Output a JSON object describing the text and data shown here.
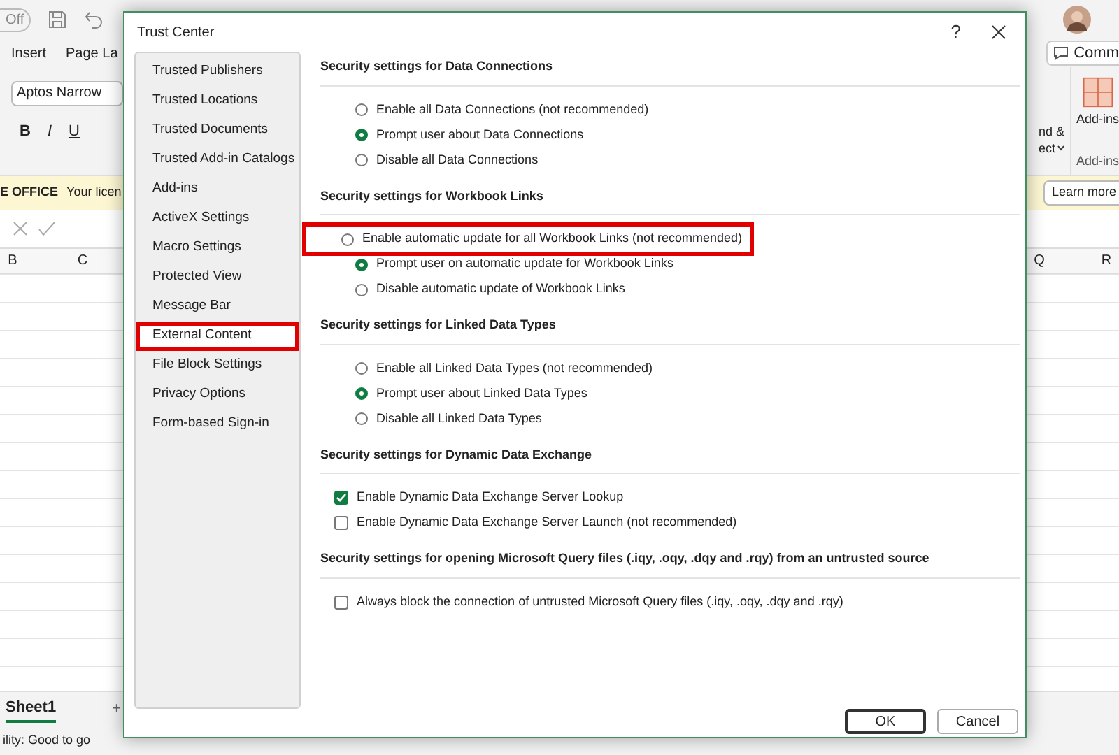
{
  "excel": {
    "autosave": "Off",
    "ribbon_tabs": [
      "Insert",
      "Page La"
    ],
    "font_box": "Aptos Narrow",
    "format_buttons": [
      "B",
      "I",
      "U"
    ],
    "license_bar": {
      "label": "E OFFICE",
      "message": "Your licen",
      "button": "Learn more"
    },
    "comments_button": "Comm",
    "find_select": [
      "nd &",
      "ect"
    ],
    "addins_button": "Add-ins",
    "addins_group": "Add-ins",
    "columns_left": [
      "B",
      "C"
    ],
    "columns_right": [
      "Q",
      "R"
    ],
    "sheet_tab": "Sheet1",
    "add_sheet": "+",
    "status": "ility: Good to go"
  },
  "dialog": {
    "title": "Trust Center",
    "help": "?",
    "sidebar": [
      {
        "label": "Trusted Publishers",
        "selected": false,
        "highlighted": false
      },
      {
        "label": "Trusted Locations",
        "selected": false,
        "highlighted": false
      },
      {
        "label": "Trusted Documents",
        "selected": false,
        "highlighted": false
      },
      {
        "label": "Trusted Add-in Catalogs",
        "selected": false,
        "highlighted": false
      },
      {
        "label": "Add-ins",
        "selected": false,
        "highlighted": false
      },
      {
        "label": "ActiveX Settings",
        "selected": false,
        "highlighted": false
      },
      {
        "label": "Macro Settings",
        "selected": false,
        "highlighted": false
      },
      {
        "label": "Protected View",
        "selected": false,
        "highlighted": false
      },
      {
        "label": "Message Bar",
        "selected": false,
        "highlighted": false
      },
      {
        "label": "External Content",
        "selected": true,
        "highlighted": true
      },
      {
        "label": "File Block Settings",
        "selected": false,
        "highlighted": false
      },
      {
        "label": "Privacy Options",
        "selected": false,
        "highlighted": false
      },
      {
        "label": "Form-based Sign-in",
        "selected": false,
        "highlighted": false
      }
    ],
    "sections": [
      {
        "title": "Security settings for Data Connections",
        "options": [
          {
            "kind": "radio",
            "label": "Enable all Data Connections (not recommended)",
            "selected": false,
            "highlighted": false
          },
          {
            "kind": "radio",
            "label": "Prompt user about Data Connections",
            "selected": true,
            "highlighted": false
          },
          {
            "kind": "radio",
            "label": "Disable all Data Connections",
            "selected": false,
            "highlighted": false
          }
        ]
      },
      {
        "title": "Security settings for Workbook Links",
        "options": [
          {
            "kind": "radio",
            "label": "Enable automatic update for all Workbook Links (not recommended)",
            "selected": false,
            "highlighted": true
          },
          {
            "kind": "radio",
            "label": "Prompt user on automatic update for Workbook Links",
            "selected": true,
            "highlighted": false
          },
          {
            "kind": "radio",
            "label": "Disable automatic update of Workbook Links",
            "selected": false,
            "highlighted": false
          }
        ]
      },
      {
        "title": "Security settings for Linked Data Types",
        "options": [
          {
            "kind": "radio",
            "label": "Enable all Linked Data Types (not recommended)",
            "selected": false,
            "highlighted": false
          },
          {
            "kind": "radio",
            "label": "Prompt user about Linked Data Types",
            "selected": true,
            "highlighted": false
          },
          {
            "kind": "radio",
            "label": "Disable all Linked Data Types",
            "selected": false,
            "highlighted": false
          }
        ]
      },
      {
        "title": "Security settings for Dynamic Data Exchange",
        "options": [
          {
            "kind": "checkbox",
            "label": "Enable Dynamic Data Exchange Server Lookup",
            "checked": true,
            "highlighted": false
          },
          {
            "kind": "checkbox",
            "label": "Enable Dynamic Data Exchange Server Launch (not recommended)",
            "checked": false,
            "highlighted": false
          }
        ]
      },
      {
        "title": "Security settings for opening  Microsoft Query files (.iqy, .oqy, .dqy and .rqy) from an untrusted source",
        "options": [
          {
            "kind": "checkbox",
            "label": "Always block the connection of untrusted Microsoft Query files (.iqy, .oqy, .dqy and .rqy)",
            "checked": false,
            "highlighted": false
          }
        ]
      }
    ],
    "buttons": [
      "OK",
      "Cancel"
    ]
  }
}
